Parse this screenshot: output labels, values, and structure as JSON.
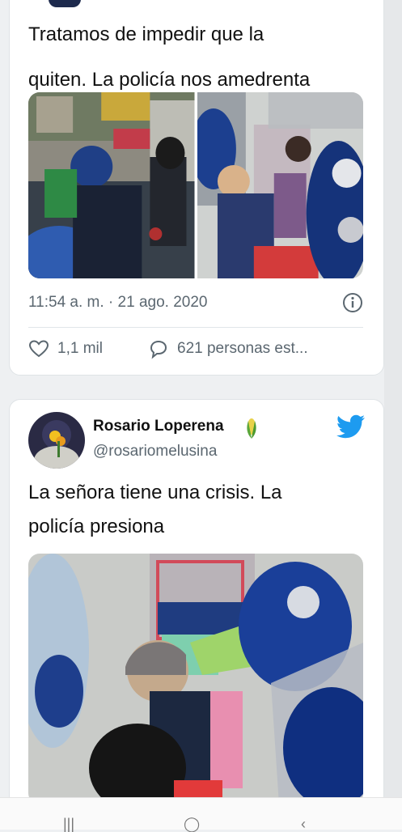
{
  "tweet1": {
    "text_line1": "Tratamos de impedir que la",
    "text_line2": "quiten. La policía nos amedrenta",
    "timestamp": "11:54 a. m. · 21 ago. 2020",
    "likes": "1,1 mil",
    "replies": "621 personas est..."
  },
  "tweet2": {
    "author_name": "Rosario Loperena",
    "author_handle": "@rosariomelusina",
    "text_line1": "La señora tiene una crisis. La",
    "text_line2": "policía presiona"
  },
  "icons": {
    "info": "info-icon",
    "like": "heart-icon",
    "reply": "speech-bubble-icon",
    "verified": "corn-emoji-icon",
    "brand": "twitter-bird-icon",
    "nav": [
      "recent-apps-icon",
      "home-icon",
      "back-icon"
    ]
  },
  "colors": {
    "brand_blue": "#1d9bf0",
    "secondary_text": "#5b6770",
    "card_background": "#ffffff"
  }
}
